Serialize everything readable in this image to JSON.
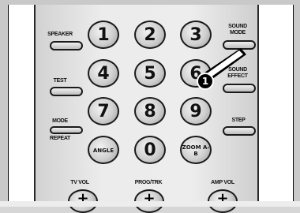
{
  "buttons": {
    "row1": [
      "1",
      "2",
      "3"
    ],
    "row2": [
      "4",
      "5",
      "6"
    ],
    "row3": [
      "7",
      "8",
      "9"
    ],
    "row4": [
      "ANGLE",
      "0",
      "ZOOM A-B"
    ]
  },
  "labels": {
    "speaker": "SPEAKER",
    "sound_mode": "SOUND MODE",
    "test": "TEST",
    "sound_effect": "SOUND EFFECT",
    "mode": "MODE",
    "repeat": "REPEAT",
    "step": "STEP",
    "tv_vol": "TV VOL",
    "prog_trk": "PROG/TRK",
    "amp_vol": "AMP VOL"
  },
  "callout": {
    "number": "1"
  },
  "plus_symbol": "+"
}
